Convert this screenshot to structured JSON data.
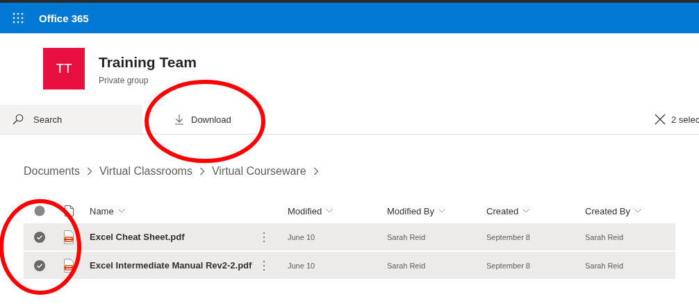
{
  "app_bar": {
    "title": "Office 365"
  },
  "group": {
    "initials": "TT",
    "name": "Training Team",
    "privacy": "Private group"
  },
  "command_bar": {
    "search": {
      "placeholder": "Search"
    },
    "actions": [
      {
        "label": "Download"
      }
    ],
    "selection": "2 selec"
  },
  "breadcrumb": [
    "Documents",
    "Virtual Classrooms",
    "Virtual Courseware"
  ],
  "table": {
    "columns": [
      "Name",
      "Modified",
      "Modified By",
      "Created",
      "Created By"
    ],
    "rows": [
      {
        "selected": true,
        "name": "Excel Cheat Sheet.pdf",
        "modified": "June 10",
        "modified_by": "Sarah Reid",
        "created": "September 8",
        "created_by": "Sarah Reid"
      },
      {
        "selected": true,
        "name": "Excel Intermediate Manual Rev2-2.pdf",
        "modified": "June 10",
        "modified_by": "Sarah Reid",
        "created": "September 8",
        "created_by": "Sarah Reid"
      }
    ]
  },
  "annotations": [
    {
      "kind": "circle"
    },
    {
      "kind": "circle"
    }
  ]
}
